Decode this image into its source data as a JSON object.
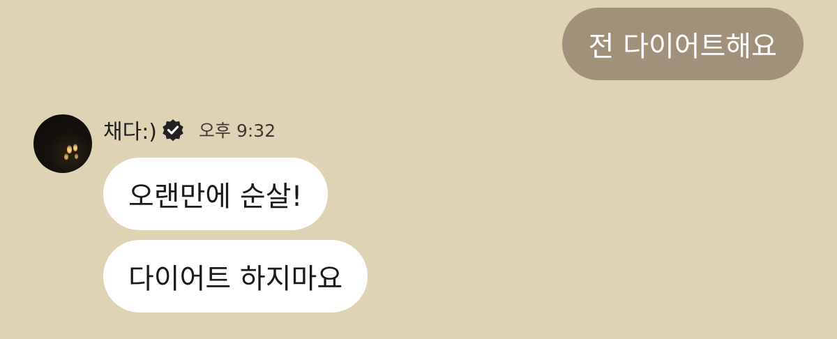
{
  "colors": {
    "background": "#dfd3b5",
    "outgoing_bubble": "#a1917a",
    "incoming_bubble": "#ffffff",
    "verified_badge": "#222222"
  },
  "outgoing_messages": [
    {
      "text": "전 다이어트해요"
    }
  ],
  "sender": {
    "name": "채다:)",
    "verified_icon": "verified-badge-icon",
    "time": "오후 9:32"
  },
  "incoming_messages": [
    {
      "text": "오랜만에 순살!"
    },
    {
      "text": "다이어트 하지마요"
    }
  ]
}
